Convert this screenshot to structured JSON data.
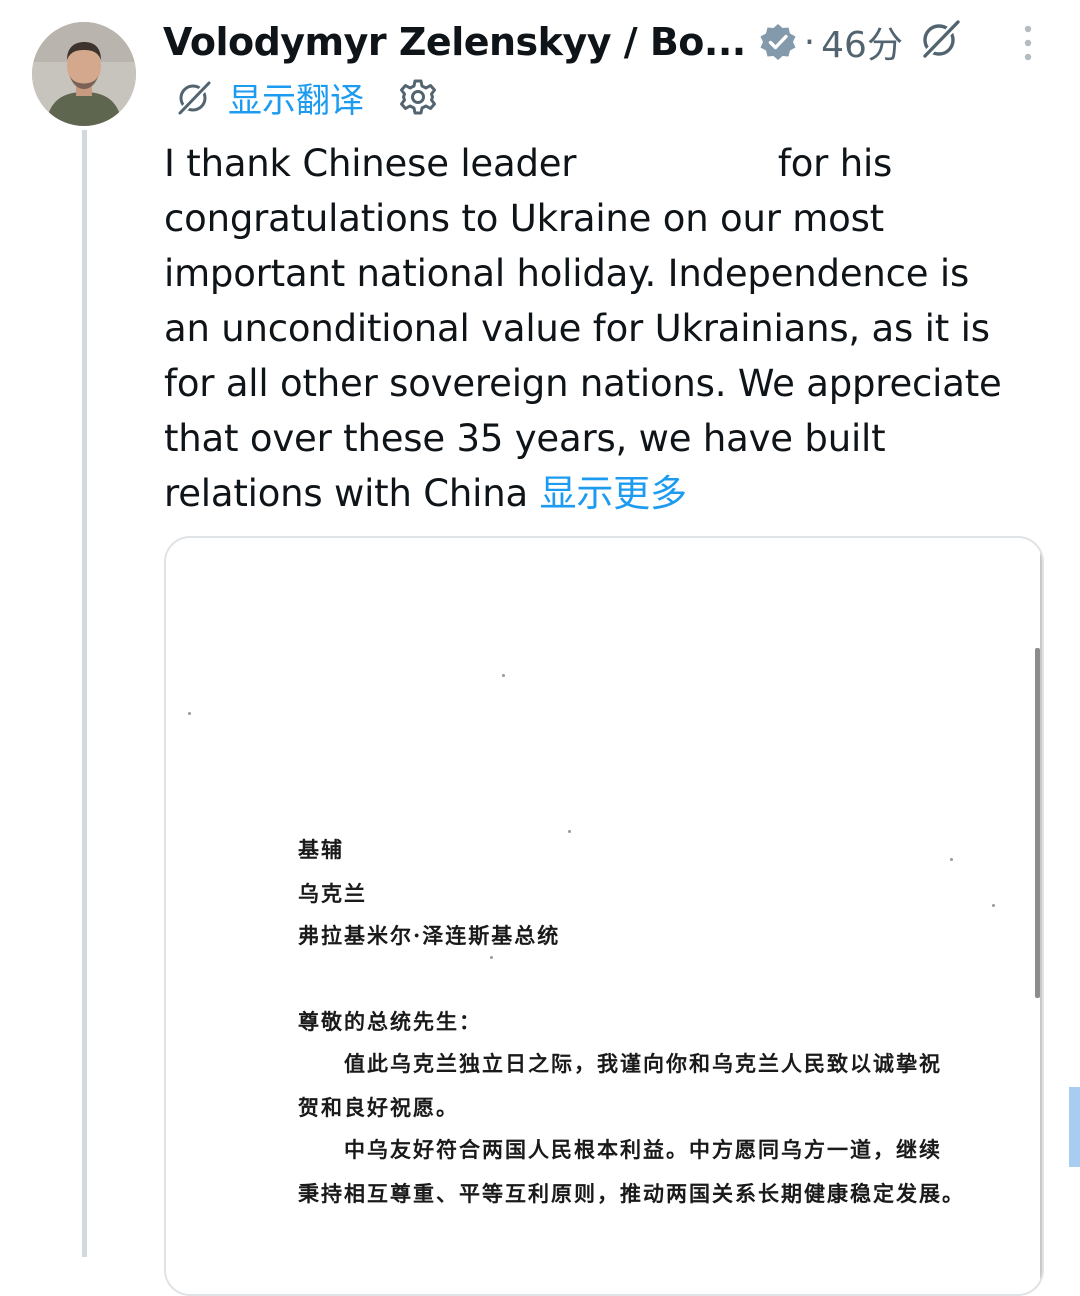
{
  "author": {
    "name": "Volodymyr Zelenskyy / Bo...",
    "separator": "·",
    "time": "46分"
  },
  "translation": {
    "label": "显示翻译"
  },
  "tweet": {
    "lines": [
      "I thank Chinese leader",
      "for his",
      "congratulations to Ukraine on our most",
      "important national holiday. Independence is",
      "an unconditional value for Ukrainians, as it is",
      "for all other sovereign nations. We appreciate",
      "that over these 35 years, we have built",
      "relations with China"
    ],
    "show_more": "显示更多"
  },
  "letter": {
    "lines": [
      "基辅",
      "乌克兰",
      "弗拉基米尔·泽连斯基总统",
      "尊敬的总统先生：",
      "值此乌克兰独立日之际，我谨向你和乌克兰人民致以诚挚祝",
      "贺和良好祝愿。",
      "中乌友好符合两国人民根本利益。中方愿同乌方一道，继续",
      "秉持相互尊重、平等互利原则，推动两国关系长期健康稳定发展。"
    ]
  },
  "icons": {
    "verified": "verified-badge-icon",
    "grok": "grok-icon",
    "more": "more-vertical-icon",
    "translate": "translate-icon",
    "settings": "gear-icon"
  },
  "colors": {
    "link": "#1d9bf0",
    "secondary": "#536471",
    "verified": "#829aab"
  }
}
